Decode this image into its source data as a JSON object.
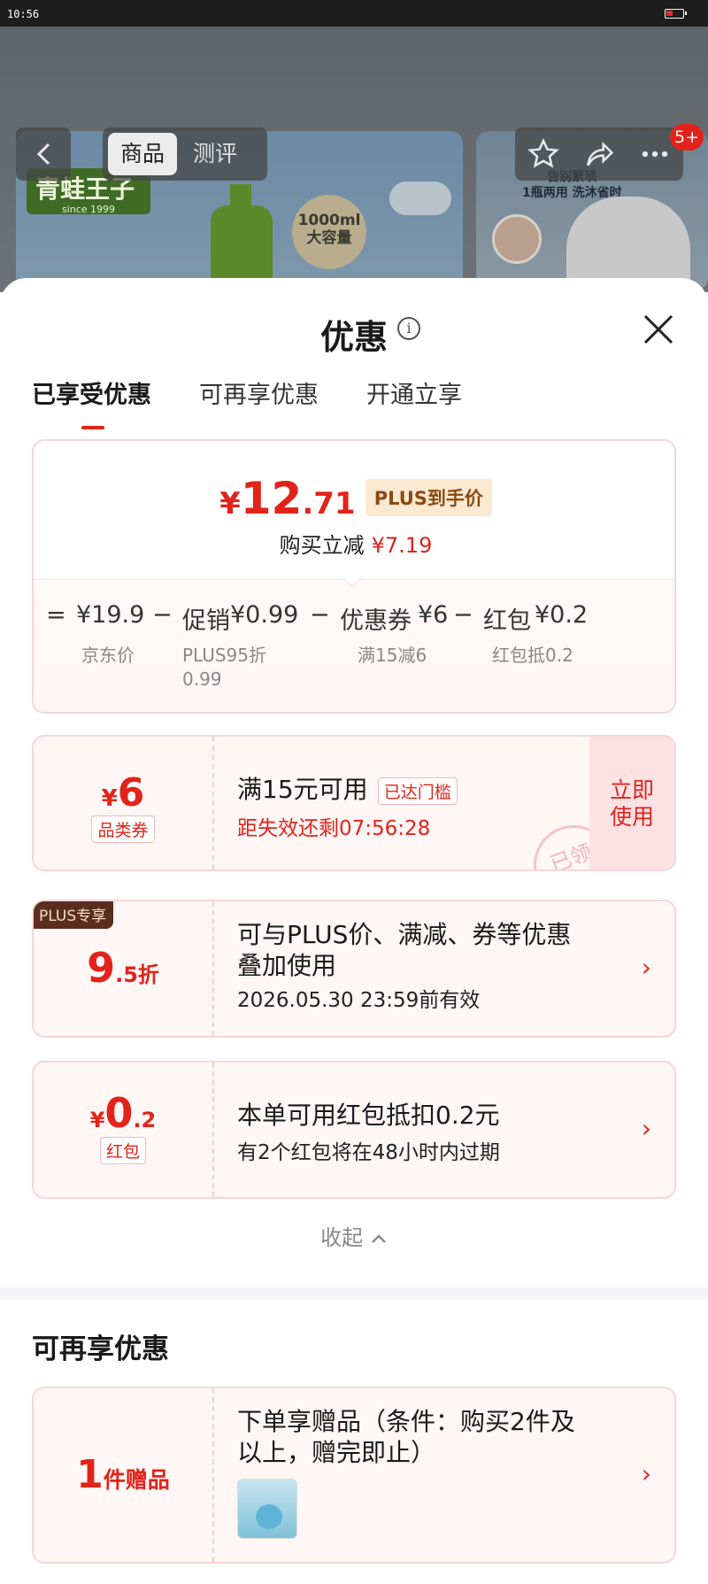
{
  "status_bar": {
    "time": "10:56"
  },
  "backdrop": {
    "brand_name": "青蛙王子",
    "brand_since": "since 1999",
    "capacity": "1000ml\n大容量",
    "banner_text": "告别繁琐\n1瓶两用 洗沐省时"
  },
  "nav": {
    "tabs": [
      "商品",
      "测评"
    ],
    "active_tab": "商品",
    "badge": "5+"
  },
  "sheet": {
    "title": "优惠",
    "tabs": [
      "已享受优惠",
      "可再享优惠",
      "开通立享"
    ],
    "active_tab": "已享受优惠"
  },
  "summary": {
    "price_symbol": "¥",
    "price_int": "12",
    "price_dec": ".71",
    "price_tag": "PLUS到手价",
    "instant_label": "购买立减",
    "instant_value": "¥7.19",
    "formula": [
      {
        "op": "=",
        "amount": "¥19.9",
        "label": "",
        "sub": "京东价"
      },
      {
        "op": "−",
        "amount": "¥0.99",
        "label": "促销",
        "sub": "PLUS95折\n0.99"
      },
      {
        "op": "−",
        "amount": "¥6",
        "label": "优惠券",
        "sub": "满15减6"
      },
      {
        "op": "−",
        "amount": "¥0.2",
        "label": "红包",
        "sub": "红包抵0.2"
      }
    ]
  },
  "coupons": [
    {
      "value_symbol": "¥",
      "value": "6",
      "value_tag": "品类券",
      "title": "满15元可用",
      "title_tag": "已达门槛",
      "desc": "距失效还剩07:56:28",
      "action": "立即\n使用",
      "stamp": "已领"
    },
    {
      "corner": "PLUS专享",
      "value_big": "9",
      "value_small": ".5折",
      "title": "可与PLUS价、满减、券等优惠\n叠加使用",
      "desc": "2026.05.30 23:59前有效"
    },
    {
      "value_symbol": "¥",
      "value_big": "0",
      "value_small": ".2",
      "value_tag": "红包",
      "title": "本单可用红包抵扣0.2元",
      "desc": "有2个红包将在48小时内过期"
    }
  ],
  "collapse_label": "收起",
  "more_section": {
    "title": "可再享优惠",
    "gift_count": "1",
    "gift_label": "件赠品",
    "gift_title": "下单享赠品（条件：购买2件及\n以上，赠完即止）"
  },
  "colors": {
    "accent": "#e2231a",
    "plus_tag_bg": "#fce9d2",
    "plus_tag_fg": "#8b4a12",
    "card_bg": "#fff6f6"
  }
}
